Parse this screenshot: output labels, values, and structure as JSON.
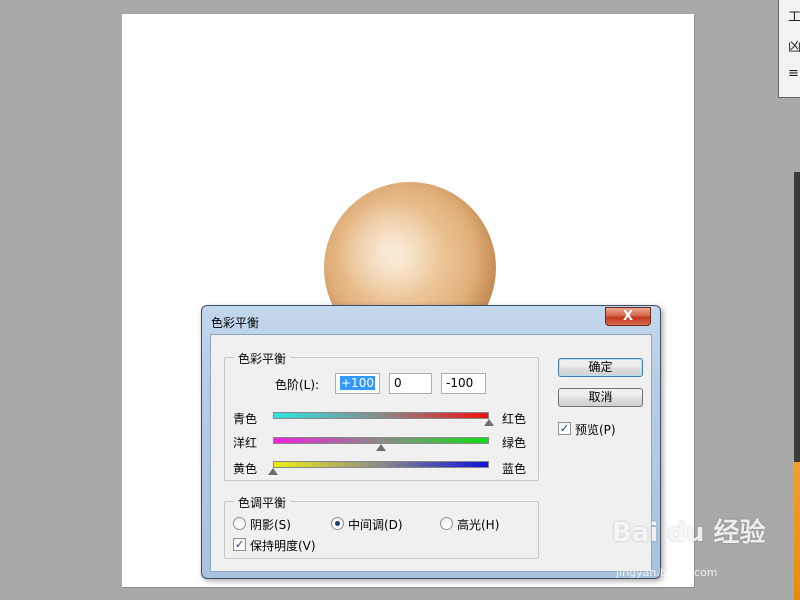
{
  "dialog": {
    "title": "色彩平衡",
    "close_label": "X",
    "color_balance": {
      "group_label": "色彩平衡",
      "levels_label": "色阶(L):",
      "levels": [
        "+100",
        "0",
        "-100"
      ],
      "sliders": [
        {
          "left": "青色",
          "right": "红色",
          "value": 100,
          "colors": [
            "#2ee3e3",
            "#ee1111"
          ]
        },
        {
          "left": "洋红",
          "right": "绿色",
          "value": 0,
          "colors": [
            "#ee22dd",
            "#11dd11"
          ]
        },
        {
          "left": "黄色",
          "right": "蓝色",
          "value": -100,
          "colors": [
            "#eeee11",
            "#1111dd"
          ]
        }
      ]
    },
    "tone_balance": {
      "group_label": "色调平衡",
      "options": [
        "阴影(S)",
        "中间调(D)",
        "高光(H)"
      ],
      "selected": "中间调(D)",
      "preserve_luminosity_label": "保持明度(V)",
      "preserve_luminosity": true
    },
    "buttons": {
      "ok": "确定",
      "cancel": "取消"
    },
    "preview_label": "预览(P)",
    "preview": true
  },
  "watermark": {
    "text": "Bai du 经验",
    "url": "jingyan.baidu.com"
  },
  "colors": {
    "sphere": "#e8bd8c",
    "titlebar": "#b7cde5",
    "close": "#c0391b"
  }
}
